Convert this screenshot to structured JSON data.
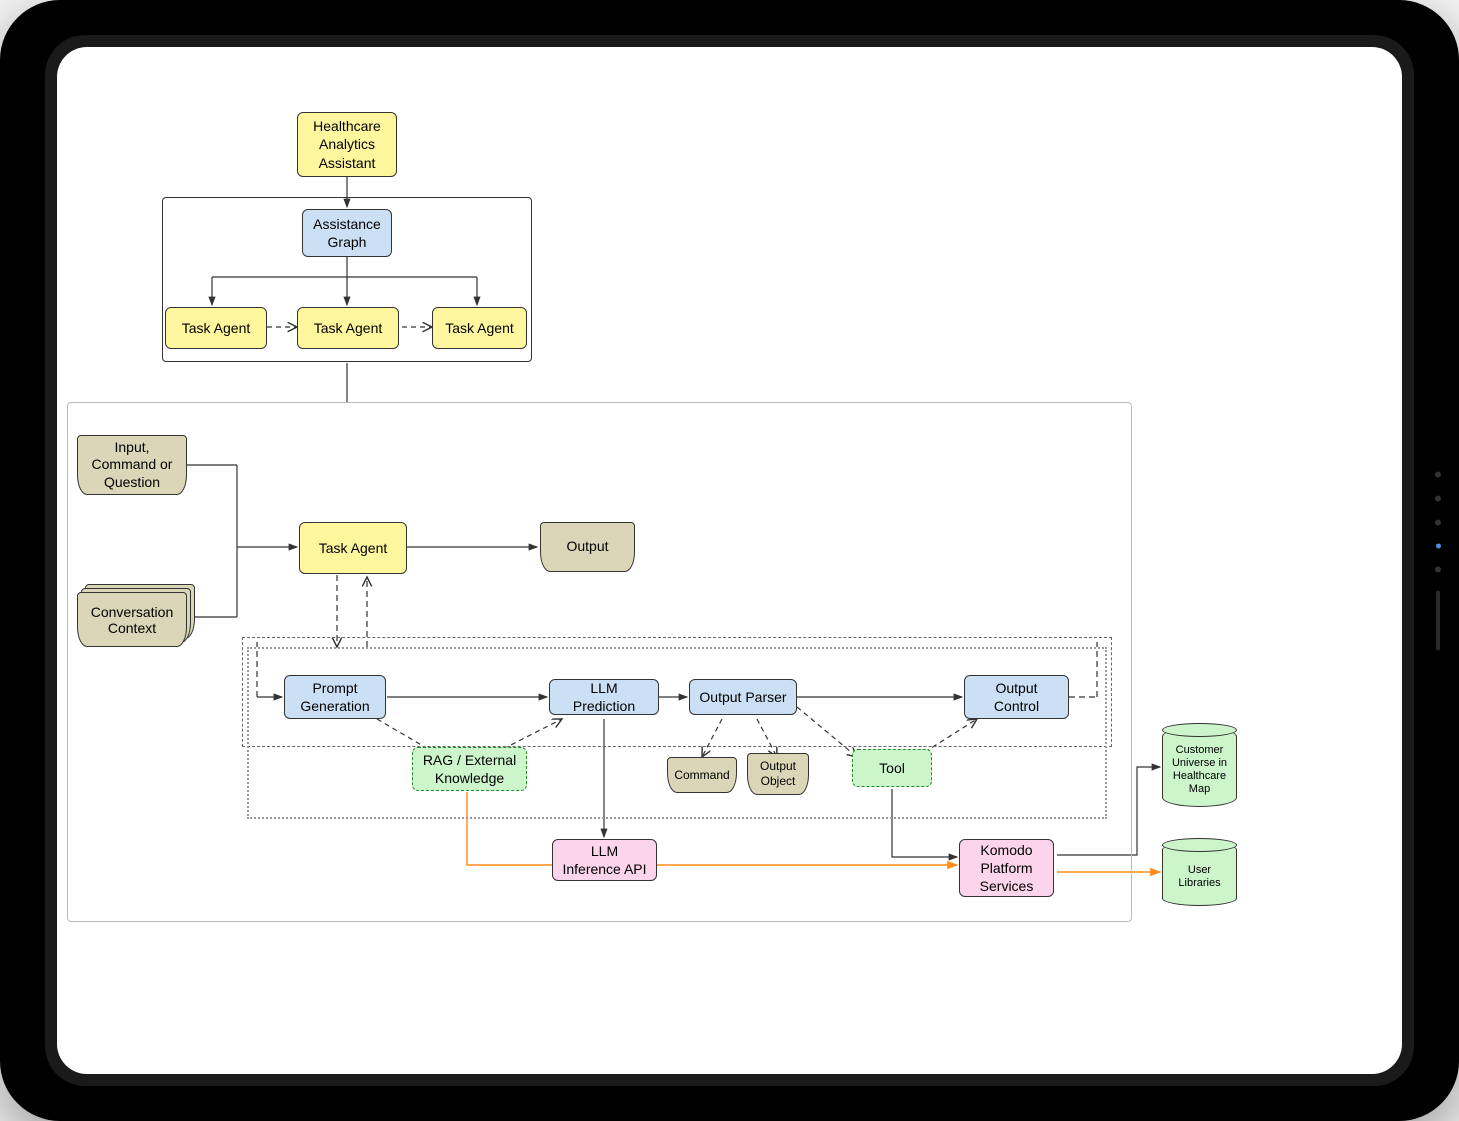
{
  "diagram": {
    "top": {
      "root": "Healthcare Analytics Assistant",
      "assistance_graph": "Assistance Graph",
      "task_agents": [
        "Task Agent",
        "Task Agent",
        "Task Agent"
      ]
    },
    "flow": {
      "input": "Input, Command or Question",
      "context": "Conversation Context",
      "task_agent": "Task Agent",
      "output": "Output"
    },
    "pipeline": {
      "prompt_generation": "Prompt Generation",
      "llm_prediction": "LLM Prediction",
      "output_parser": "Output Parser",
      "output_control": "Output Control",
      "rag": "RAG / External Knowledge",
      "command": "Command",
      "output_object": "Output Object",
      "tool": "Tool",
      "llm_api": "LLM Inference API",
      "komodo": "Komodo Platform Services"
    },
    "stores": {
      "customer_universe": "Customer Universe in Healthcare Map",
      "user_libraries": "User Libraries"
    }
  },
  "colors": {
    "yellow": "#fff79e",
    "blue": "#cce0f5",
    "green": "#ccf5cc",
    "pink": "#fcd5ec",
    "tan": "#dcd6b8",
    "orange_line": "#ff8c1a"
  }
}
